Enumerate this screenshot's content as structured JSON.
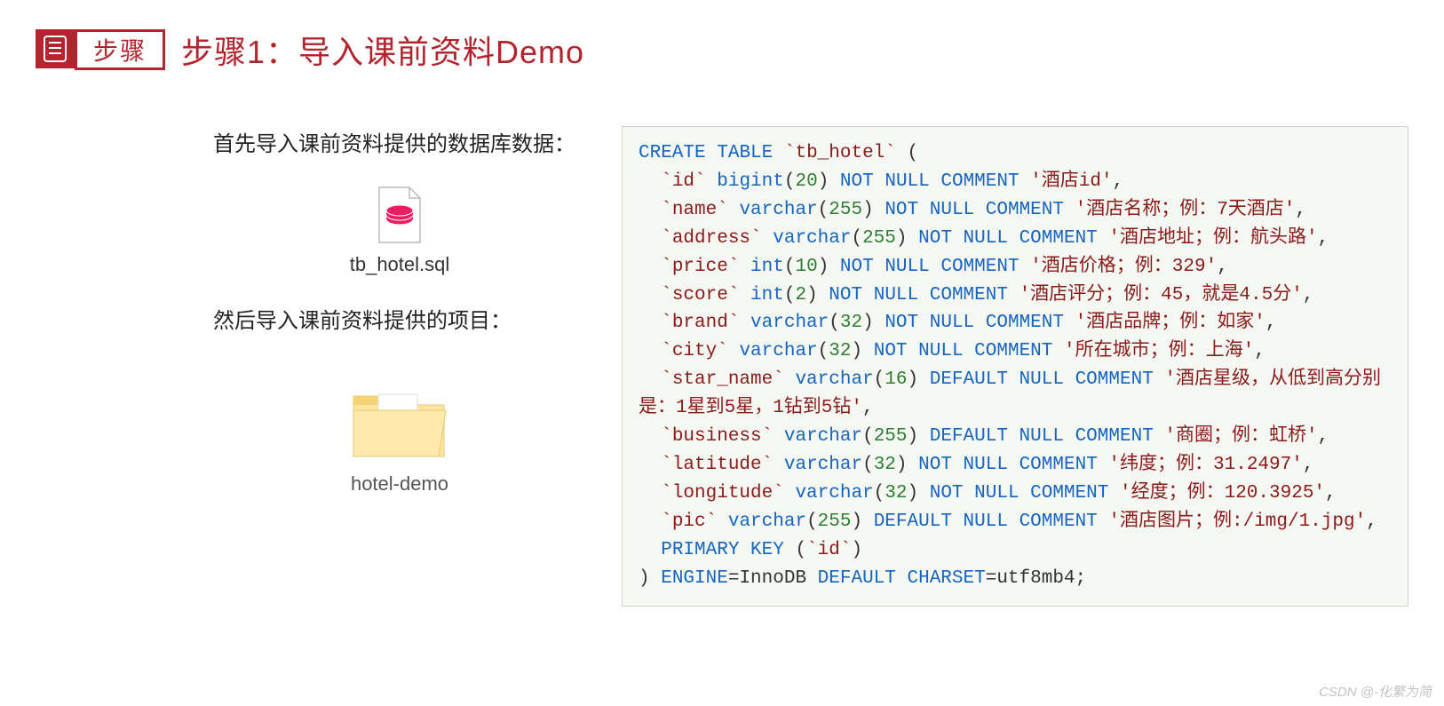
{
  "badge": {
    "label": "步骤"
  },
  "title": "步骤1：导入课前资料Demo",
  "intro1": "首先导入课前资料提供的数据库数据：",
  "file1": "tb_hotel.sql",
  "intro2": "然后导入课前资料提供的项目：",
  "file2": "hotel-demo",
  "code_html": "<span class=\"kw\">CREATE</span> <span class=\"kw\">TABLE</span> <span class=\"id\">`tb_hotel`</span> (\n  <span class=\"id\">`id`</span> <span class=\"ty\">bigint</span>(<span class=\"num\">20</span>) <span class=\"ty\">NOT</span> <span class=\"ty\">NULL</span> <span class=\"ty\">COMMENT</span> <span class=\"str\">'酒店id'</span>,\n  <span class=\"id\">`name`</span> <span class=\"ty\">varchar</span>(<span class=\"num\">255</span>) <span class=\"ty\">NOT</span> <span class=\"ty\">NULL</span> <span class=\"ty\">COMMENT</span> <span class=\"str\">'酒店名称；例：7天酒店'</span>,\n  <span class=\"id\">`address`</span> <span class=\"ty\">varchar</span>(<span class=\"num\">255</span>) <span class=\"ty\">NOT</span> <span class=\"ty\">NULL</span> <span class=\"ty\">COMMENT</span> <span class=\"str\">'酒店地址；例：航头路'</span>,\n  <span class=\"id\">`price`</span> <span class=\"ty\">int</span>(<span class=\"num\">10</span>) <span class=\"ty\">NOT</span> <span class=\"ty\">NULL</span> <span class=\"ty\">COMMENT</span> <span class=\"str\">'酒店价格；例：329'</span>,\n  <span class=\"id\">`score`</span> <span class=\"ty\">int</span>(<span class=\"num\">2</span>) <span class=\"ty\">NOT</span> <span class=\"ty\">NULL</span> <span class=\"ty\">COMMENT</span> <span class=\"str\">'酒店评分；例：45，就是4.5分'</span>,\n  <span class=\"id\">`brand`</span> <span class=\"ty\">varchar</span>(<span class=\"num\">32</span>) <span class=\"ty\">NOT</span> <span class=\"ty\">NULL</span> <span class=\"ty\">COMMENT</span> <span class=\"str\">'酒店品牌；例：如家'</span>,\n  <span class=\"id\">`city`</span> <span class=\"ty\">varchar</span>(<span class=\"num\">32</span>) <span class=\"ty\">NOT</span> <span class=\"ty\">NULL</span> <span class=\"ty\">COMMENT</span> <span class=\"str\">'所在城市；例：上海'</span>,\n  <span class=\"id\">`star_name`</span> <span class=\"ty\">varchar</span>(<span class=\"num\">16</span>) <span class=\"ty\">DEFAULT</span> <span class=\"ty\">NULL</span> <span class=\"ty\">COMMENT</span> <span class=\"str\">'酒店星级，从低到高分别是：1星到5星，1钻到5钻'</span>,\n  <span class=\"id\">`business`</span> <span class=\"ty\">varchar</span>(<span class=\"num\">255</span>) <span class=\"ty\">DEFAULT</span> <span class=\"ty\">NULL</span> <span class=\"ty\">COMMENT</span> <span class=\"str\">'商圈；例：虹桥'</span>,\n  <span class=\"id\">`latitude`</span> <span class=\"ty\">varchar</span>(<span class=\"num\">32</span>) <span class=\"ty\">NOT</span> <span class=\"ty\">NULL</span> <span class=\"ty\">COMMENT</span> <span class=\"str\">'纬度；例：31.2497'</span>,\n  <span class=\"id\">`longitude`</span> <span class=\"ty\">varchar</span>(<span class=\"num\">32</span>) <span class=\"ty\">NOT</span> <span class=\"ty\">NULL</span> <span class=\"ty\">COMMENT</span> <span class=\"str\">'经度；例：120.3925'</span>,\n  <span class=\"id\">`pic`</span> <span class=\"ty\">varchar</span>(<span class=\"num\">255</span>) <span class=\"ty\">DEFAULT</span> <span class=\"ty\">NULL</span> <span class=\"ty\">COMMENT</span> <span class=\"str\">'酒店图片；例:/img/1.jpg'</span>,\n  <span class=\"kw\">PRIMARY</span> <span class=\"kw\">KEY</span> (<span class=\"id\">`id`</span>)\n) <span class=\"ty\">ENGINE</span>=InnoDB <span class=\"ty\">DEFAULT</span> <span class=\"ty\">CHARSET</span>=utf8mb4;",
  "attribution": "CSDN @-化繁为简"
}
